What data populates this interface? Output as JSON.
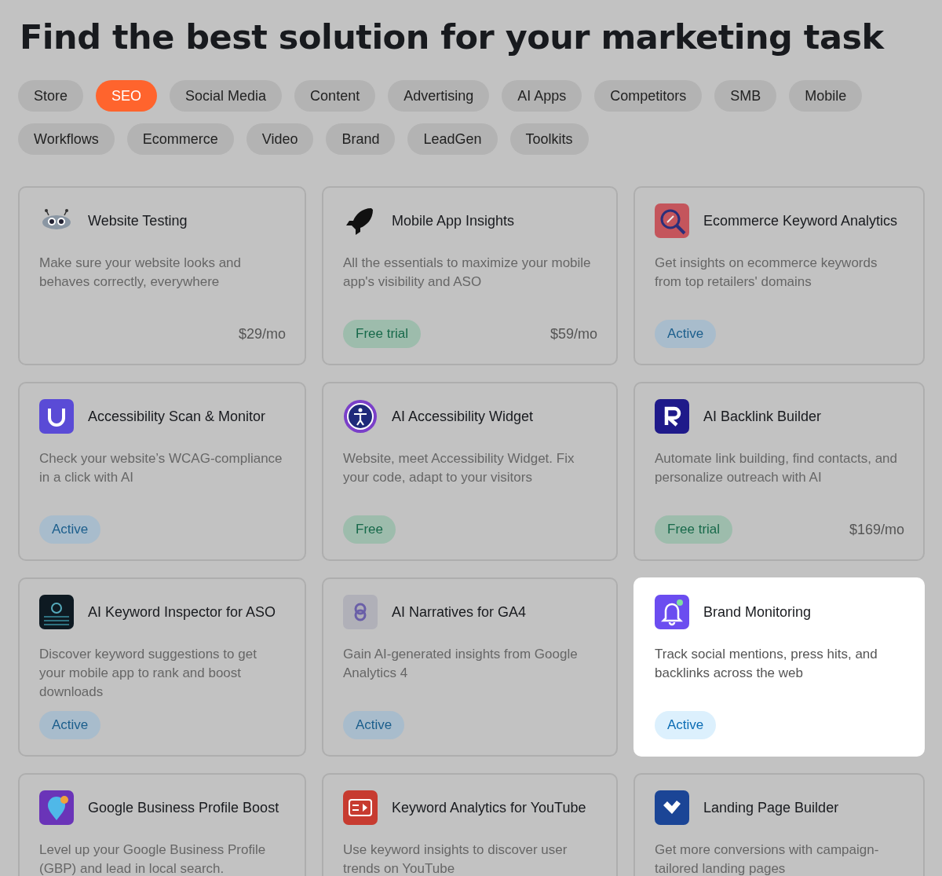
{
  "title": "Find the best solution for your marketing task",
  "filters": [
    {
      "label": "Store",
      "selected": false
    },
    {
      "label": "SEO",
      "selected": true
    },
    {
      "label": "Social Media",
      "selected": false
    },
    {
      "label": "Content",
      "selected": false
    },
    {
      "label": "Advertising",
      "selected": false
    },
    {
      "label": "AI Apps",
      "selected": false
    },
    {
      "label": "Competitors",
      "selected": false
    },
    {
      "label": "SMB",
      "selected": false
    },
    {
      "label": "Mobile",
      "selected": false
    },
    {
      "label": "Workflows",
      "selected": false
    },
    {
      "label": "Ecommerce",
      "selected": false
    },
    {
      "label": "Video",
      "selected": false
    },
    {
      "label": "Brand",
      "selected": false
    },
    {
      "label": "LeadGen",
      "selected": false
    },
    {
      "label": "Toolkits",
      "selected": false
    }
  ],
  "cards": [
    {
      "title": "Website Testing",
      "description": "Make sure your website looks and behaves correctly, everywhere",
      "price": "$29/mo",
      "highlighted": false
    },
    {
      "title": "Mobile App Insights",
      "description": "All the essentials to maximize your mobile app's visibility and ASO",
      "badge": {
        "kind": "trial",
        "label": "Free trial"
      },
      "price": "$59/mo",
      "highlighted": false
    },
    {
      "title": "Ecommerce Keyword Analytics",
      "description": "Get insights on ecommerce keywords from top retailers' domains",
      "badge": {
        "kind": "active",
        "label": "Active"
      },
      "highlighted": false
    },
    {
      "title": "Accessibility Scan & Monitor",
      "description": "Check your website’s WCAG-compliance in a click with AI",
      "badge": {
        "kind": "active",
        "label": "Active"
      },
      "highlighted": false
    },
    {
      "title": "AI Accessibility Widget",
      "description": "Website, meet Accessibility Widget. Fix your code, adapt to your visitors",
      "badge": {
        "kind": "free",
        "label": "Free"
      },
      "highlighted": false
    },
    {
      "title": "AI Backlink Builder",
      "description": "Automate link building, find contacts, and personalize outreach with AI",
      "badge": {
        "kind": "trial",
        "label": "Free trial"
      },
      "price": "$169/mo",
      "highlighted": false
    },
    {
      "title": "AI Keyword Inspector for ASO",
      "description": "Discover keyword suggestions to get your mobile app to rank and boost downloads",
      "badge": {
        "kind": "active",
        "label": "Active"
      },
      "highlighted": false
    },
    {
      "title": "AI Narratives for GA4",
      "description": "Gain AI-generated insights from Google Analytics 4",
      "badge": {
        "kind": "active",
        "label": "Active"
      },
      "highlighted": false
    },
    {
      "title": "Brand Monitoring",
      "description": "Track social mentions, press hits, and backlinks across the web",
      "badge": {
        "kind": "active",
        "label": "Active"
      },
      "highlighted": true
    },
    {
      "title": "Google Business Profile Boost",
      "description": "Level up your Google Business Profile (GBP) and lead in local search.",
      "highlighted": false
    },
    {
      "title": "Keyword Analytics for YouTube",
      "description": "Use keyword insights to discover user trends on YouTube",
      "highlighted": false
    },
    {
      "title": "Landing Page Builder",
      "description": "Get more conversions with campaign-tailored landing pages",
      "highlighted": false
    }
  ]
}
